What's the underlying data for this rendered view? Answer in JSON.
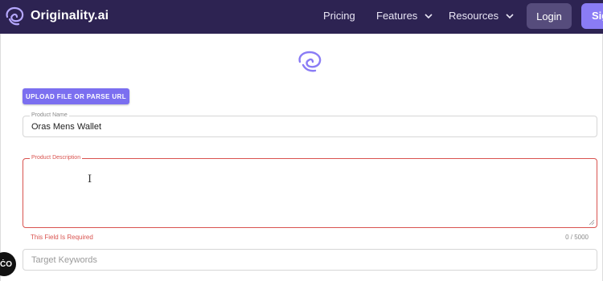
{
  "nav": {
    "brand": "Originality.ai",
    "links": [
      {
        "label": "Pricing"
      },
      {
        "label": "Features"
      },
      {
        "label": "Resources"
      }
    ],
    "login": "Login",
    "signup": "Sig"
  },
  "form": {
    "upload_button": "UPLOAD FILE OR PARSE URL",
    "product_name": {
      "label": "Product Name",
      "value": "Oras Mens Wallet"
    },
    "product_description": {
      "label": "Product Description",
      "value": "",
      "error": "This Field Is Required",
      "counter": "0 / 5000"
    },
    "target_keywords": {
      "placeholder": "Target Keywords"
    }
  },
  "floating_widget": {
    "label": "ĊO"
  },
  "colors": {
    "nav_bg": "#2d2352",
    "accent": "#8a7cf5",
    "error": "#d9534f"
  }
}
